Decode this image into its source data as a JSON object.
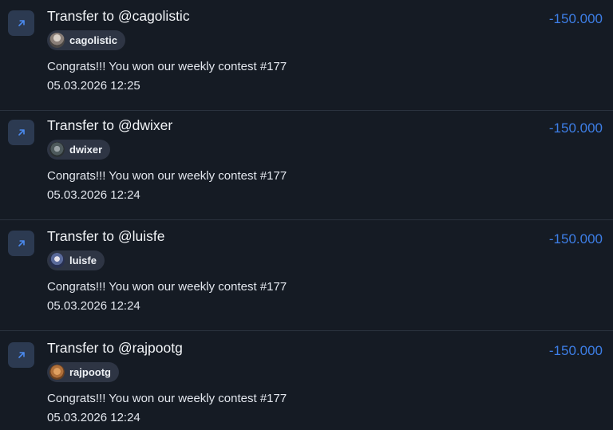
{
  "colors": {
    "background": "#151b24",
    "amount": "#3d7ee6",
    "icon_bg": "#2c3a51",
    "icon_arrow": "#4b8bf0",
    "chip_bg": "#2e3544"
  },
  "transactions": [
    {
      "title": "Transfer to @cagolistic",
      "username": "cagolistic",
      "avatar_icon": "user-avatar-icon",
      "message": "Congrats!!! You won our weekly contest #177",
      "date": "05.03.2026 12:25",
      "amount": "-150.000",
      "direction_icon": "arrow-up-right-icon"
    },
    {
      "title": "Transfer to @dwixer",
      "username": "dwixer",
      "avatar_icon": "user-avatar-icon",
      "message": "Congrats!!! You won our weekly contest #177",
      "date": "05.03.2026 12:24",
      "amount": "-150.000",
      "direction_icon": "arrow-up-right-icon"
    },
    {
      "title": "Transfer to @luisfe",
      "username": "luisfe",
      "avatar_icon": "user-avatar-icon",
      "message": "Congrats!!! You won our weekly contest #177",
      "date": "05.03.2026 12:24",
      "amount": "-150.000",
      "direction_icon": "arrow-up-right-icon"
    },
    {
      "title": "Transfer to @rajpootg",
      "username": "rajpootg",
      "avatar_icon": "user-avatar-icon",
      "message": "Congrats!!! You won our weekly contest #177",
      "date": "05.03.2026 12:24",
      "amount": "-150.000",
      "direction_icon": "arrow-up-right-icon"
    }
  ]
}
